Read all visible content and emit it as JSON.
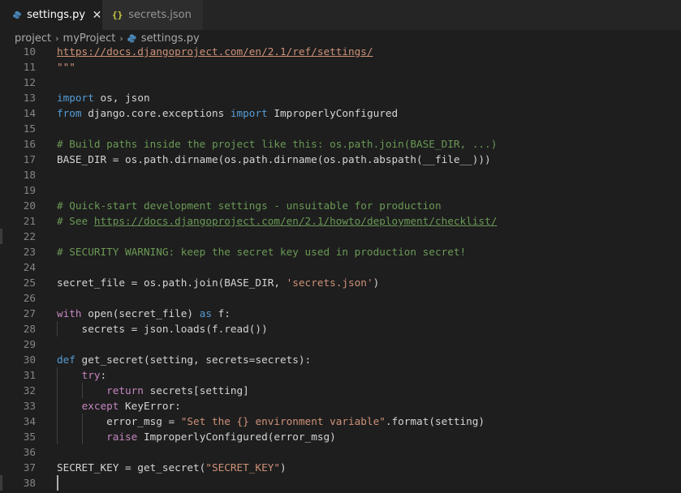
{
  "tabs": [
    {
      "label": "settings.py",
      "close": "✕",
      "active": true
    },
    {
      "label": "secrets.json",
      "icon": "{}",
      "active": false
    }
  ],
  "breadcrumb": [
    "project",
    "myProject",
    "settings.py"
  ],
  "breadcrumb_sep": "›",
  "colors": {
    "keyword": "#569cd6",
    "control": "#c586c0",
    "comment": "#6a9955",
    "string": "#ce9178",
    "text": "#d4d4d4"
  },
  "lines": [
    {
      "n": "10",
      "t": "https://docs.djangoproject.com/en/2.1/ref/settings/"
    },
    {
      "n": "11",
      "t": "\"\"\""
    },
    {
      "n": "12",
      "t": ""
    },
    {
      "n": "13",
      "t": "import os, json"
    },
    {
      "n": "14",
      "t": "from django.core.exceptions import ImproperlyConfigured"
    },
    {
      "n": "15",
      "t": ""
    },
    {
      "n": "16",
      "t": "# Build paths inside the project like this: os.path.join(BASE_DIR, ...)"
    },
    {
      "n": "17",
      "t": "BASE_DIR = os.path.dirname(os.path.dirname(os.path.abspath(__file__)))"
    },
    {
      "n": "18",
      "t": ""
    },
    {
      "n": "19",
      "t": ""
    },
    {
      "n": "20",
      "t": "# Quick-start development settings - unsuitable for production"
    },
    {
      "n": "21",
      "t": "# See https://docs.djangoproject.com/en/2.1/howto/deployment/checklist/"
    },
    {
      "n": "22",
      "t": ""
    },
    {
      "n": "23",
      "t": "# SECURITY WARNING: keep the secret key used in production secret!"
    },
    {
      "n": "24",
      "t": ""
    },
    {
      "n": "25",
      "t": "secret_file = os.path.join(BASE_DIR, 'secrets.json')"
    },
    {
      "n": "26",
      "t": ""
    },
    {
      "n": "27",
      "t": "with open(secret_file) as f:"
    },
    {
      "n": "28",
      "t": "    secrets = json.loads(f.read())"
    },
    {
      "n": "29",
      "t": ""
    },
    {
      "n": "30",
      "t": "def get_secret(setting, secrets=secrets):"
    },
    {
      "n": "31",
      "t": "    try:"
    },
    {
      "n": "32",
      "t": "        return secrets[setting]"
    },
    {
      "n": "33",
      "t": "    except KeyError:"
    },
    {
      "n": "34",
      "t": "        error_msg = \"Set the {} environment variable\".format(setting)"
    },
    {
      "n": "35",
      "t": "        raise ImproperlyConfigured(error_msg)"
    },
    {
      "n": "36",
      "t": ""
    },
    {
      "n": "37",
      "t": "SECRET_KEY = get_secret(\"SECRET_KEY\")"
    },
    {
      "n": "38",
      "t": ""
    }
  ]
}
